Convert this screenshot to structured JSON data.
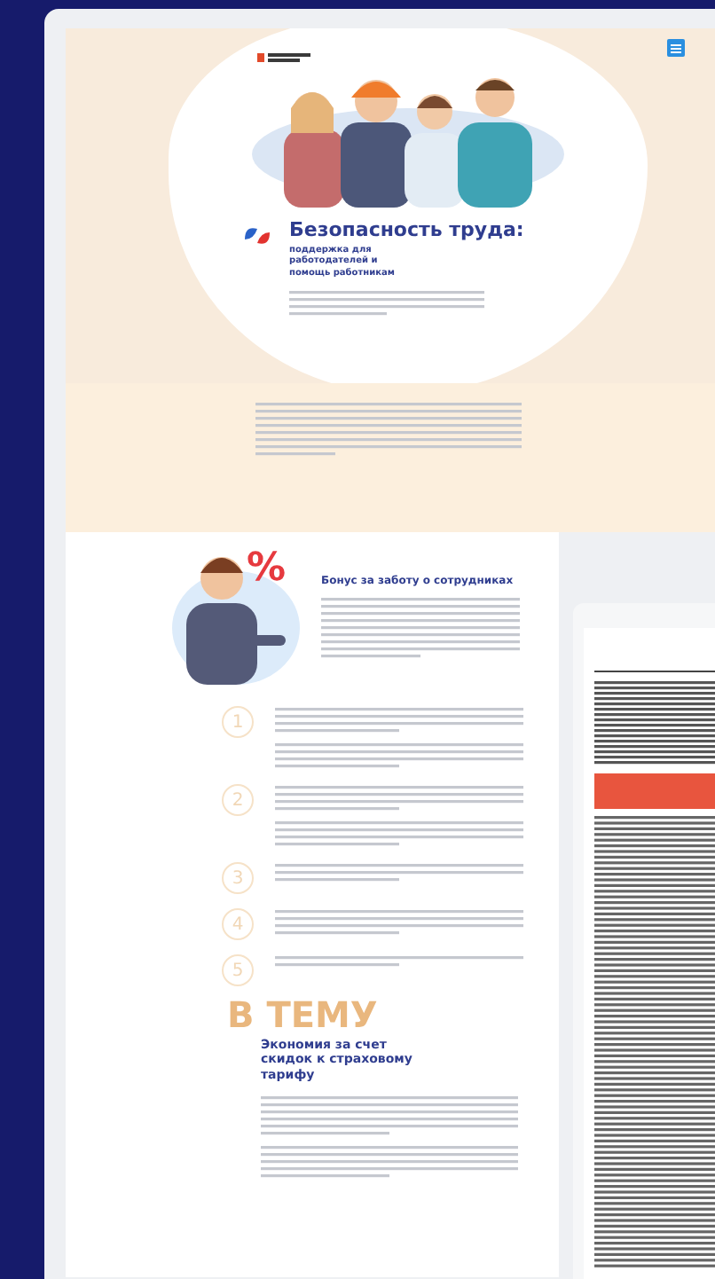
{
  "hero": {
    "title": "Безопасность труда:",
    "subtitle": "поддержка для работодателей и помощь работникам"
  },
  "bonus": {
    "title": "Бонус за заботу о сотрудниках",
    "sign": "%"
  },
  "steps": [
    {
      "number": "1"
    },
    {
      "number": "2"
    },
    {
      "number": "3"
    },
    {
      "number": "4"
    },
    {
      "number": "5"
    }
  ],
  "related": {
    "label": "В ТЕМУ",
    "title": "Экономия за счет скидок к страховому тарифу"
  }
}
